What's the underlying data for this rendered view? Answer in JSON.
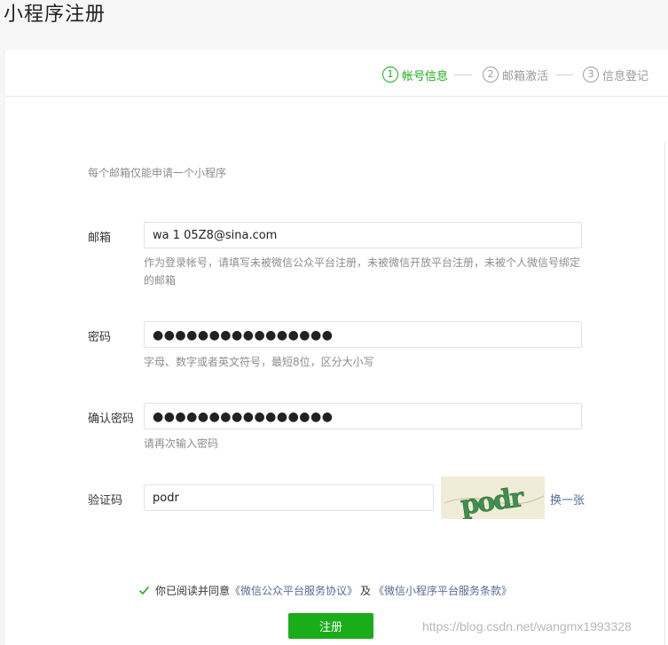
{
  "page": {
    "title": "小程序注册"
  },
  "steps": [
    {
      "number": "1",
      "label": "帐号信息",
      "active": true
    },
    {
      "number": "2",
      "label": "邮箱激活",
      "active": false
    },
    {
      "number": "3",
      "label": "信息登记",
      "active": false
    }
  ],
  "form": {
    "tip": "每个邮箱仅能申请一个小程序",
    "email": {
      "label": "邮箱",
      "value": "wa     1   05Z8@sina.com",
      "help": "作为登录帐号，请填写未被微信公众平台注册，未被微信开放平台注册，未被个人微信号绑定的邮箱"
    },
    "password": {
      "label": "密码",
      "value": "●●●●●●●●●●●●●●●●",
      "help": "字母、数字或者英文符号，最短8位，区分大小写"
    },
    "confirm_password": {
      "label": "确认密码",
      "value": "●●●●●●●●●●●●●●●●",
      "help": "请再次输入密码"
    },
    "captcha": {
      "label": "验证码",
      "value": "podr",
      "image_text": "podr",
      "refresh_label": "换一张"
    },
    "agreement": {
      "checked": true,
      "prefix": "你已阅读并同意",
      "link1": "《微信公众平台服务协议》",
      "conj": "及",
      "link2": "《微信小程序平台服务条款》"
    },
    "submit_label": "注册"
  },
  "watermark": "https://blog.csdn.net/wangmx1993328",
  "colors": {
    "accent": "#1aad19",
    "link": "#576b95"
  }
}
